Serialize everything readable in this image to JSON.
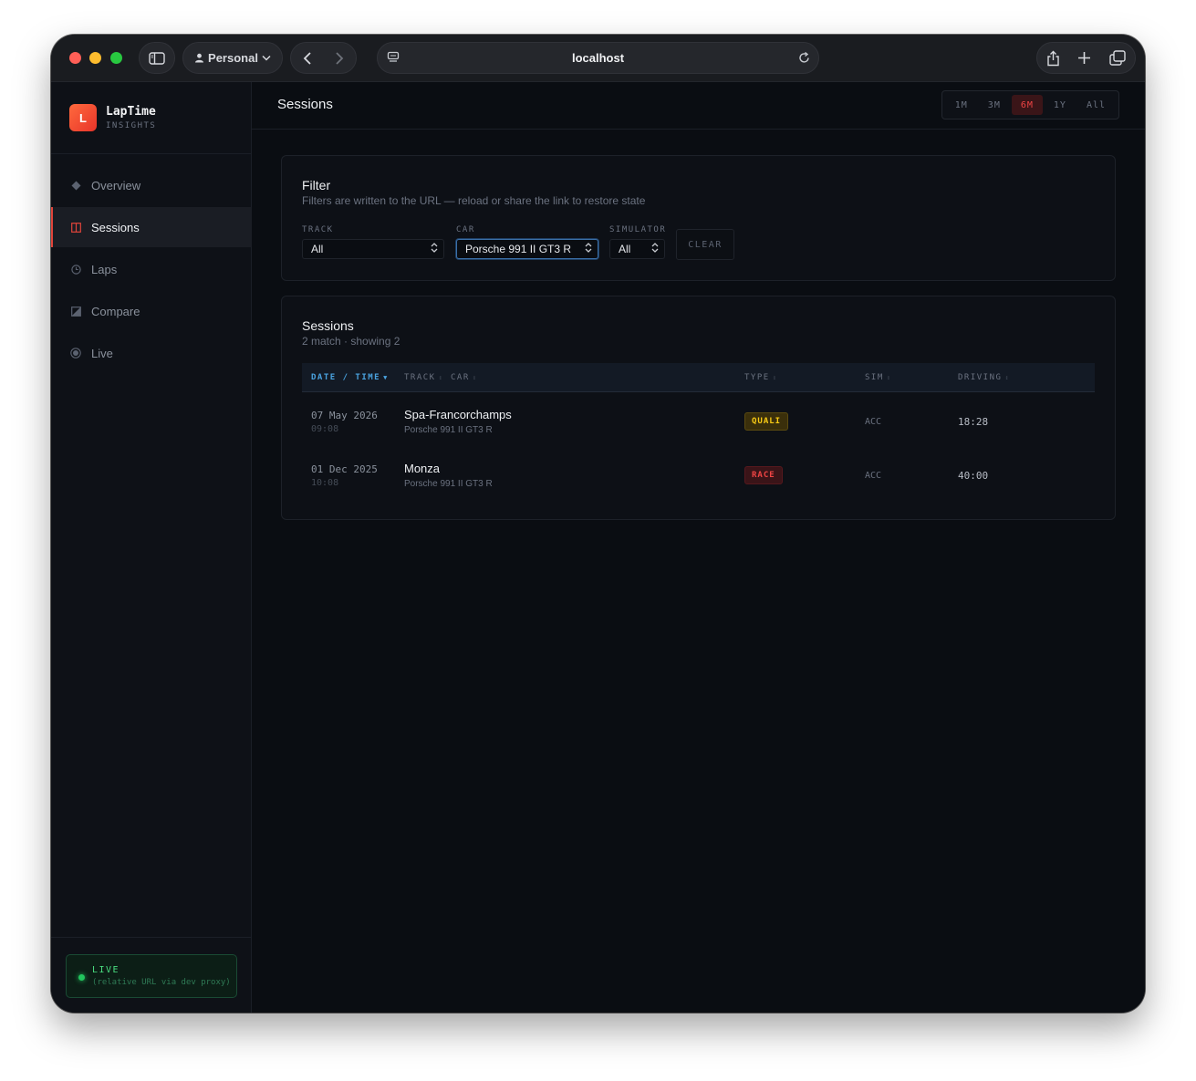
{
  "browser": {
    "profile_label": "Personal",
    "url": "localhost"
  },
  "brand": {
    "logo_letter": "L",
    "name": "LapTime",
    "subtitle": "INSIGHTS"
  },
  "nav": {
    "items": [
      {
        "label": "Overview",
        "icon": "diamond-icon"
      },
      {
        "label": "Sessions",
        "icon": "grid-icon"
      },
      {
        "label": "Laps",
        "icon": "clock-icon"
      },
      {
        "label": "Compare",
        "icon": "compare-icon"
      },
      {
        "label": "Live",
        "icon": "live-dot-icon"
      }
    ],
    "active": "Sessions"
  },
  "live_status": {
    "title": "LIVE",
    "subtitle": "(relative URL via dev proxy)"
  },
  "header": {
    "title": "Sessions",
    "ranges": [
      "1M",
      "3M",
      "6M",
      "1Y",
      "All"
    ],
    "active_range": "6M"
  },
  "filter": {
    "title": "Filter",
    "subtitle": "Filters are written to the URL — reload or share the link to restore state",
    "track_label": "TRACK",
    "track_value": "All",
    "car_label": "CAR",
    "car_value": "Porsche 991 II GT3 R",
    "sim_label": "SIMULATOR",
    "sim_value": "All",
    "clear_label": "CLEAR"
  },
  "sessions": {
    "title": "Sessions",
    "subtitle": "2 match · showing 2",
    "columns": {
      "date": "DATE / TIME",
      "track": "TRACK",
      "car": "CAR",
      "type": "TYPE",
      "sim": "SIM",
      "driving": "DRIVING"
    },
    "rows": [
      {
        "date": "07 May 2026",
        "time": "09:08",
        "track": "Spa-Francorchamps",
        "car": "Porsche 991 II GT3 R",
        "type": "QUALI",
        "sim": "ACC",
        "driving": "18:28"
      },
      {
        "date": "01 Dec 2025",
        "time": "10:08",
        "track": "Monza",
        "car": "Porsche 991 II GT3 R",
        "type": "RACE",
        "sim": "ACC",
        "driving": "40:00"
      }
    ]
  },
  "colors": {
    "accent": "#e0443a",
    "sort_blue": "#4aa3e0",
    "quali": "#facc15",
    "race": "#ef4444",
    "live_green": "#22c55e"
  }
}
